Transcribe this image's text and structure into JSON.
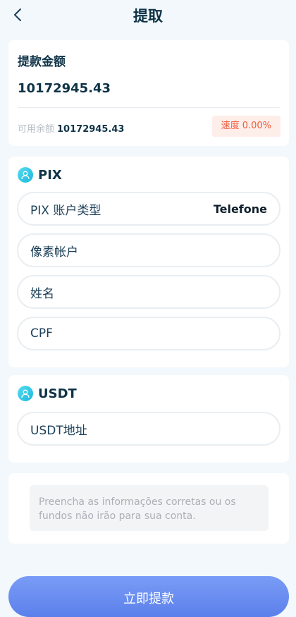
{
  "header": {
    "title": "提取"
  },
  "amount": {
    "title": "提款金额",
    "value": "10172945.43",
    "balance_label": "可用余额",
    "balance_value": "10172945.43",
    "rate": "速度 0.00%"
  },
  "pix": {
    "title": "PIX",
    "account_type_label": "PIX 账户类型",
    "account_type_value": "Telefone",
    "pixel_account_placeholder": "像素帐户",
    "name_placeholder": "姓名",
    "cpf_placeholder": "CPF"
  },
  "usdt": {
    "title": "USDT",
    "address_placeholder": "USDT地址"
  },
  "notice": "Preencha as informações corretas ou os fundos não irão para sua conta.",
  "submit_label": "立即提款",
  "colors": {
    "accent_button": "#6a8ef2",
    "section_icon": "#2cc5e6",
    "rate_text": "#f05a3c",
    "rate_bg": "#fdeeea"
  }
}
